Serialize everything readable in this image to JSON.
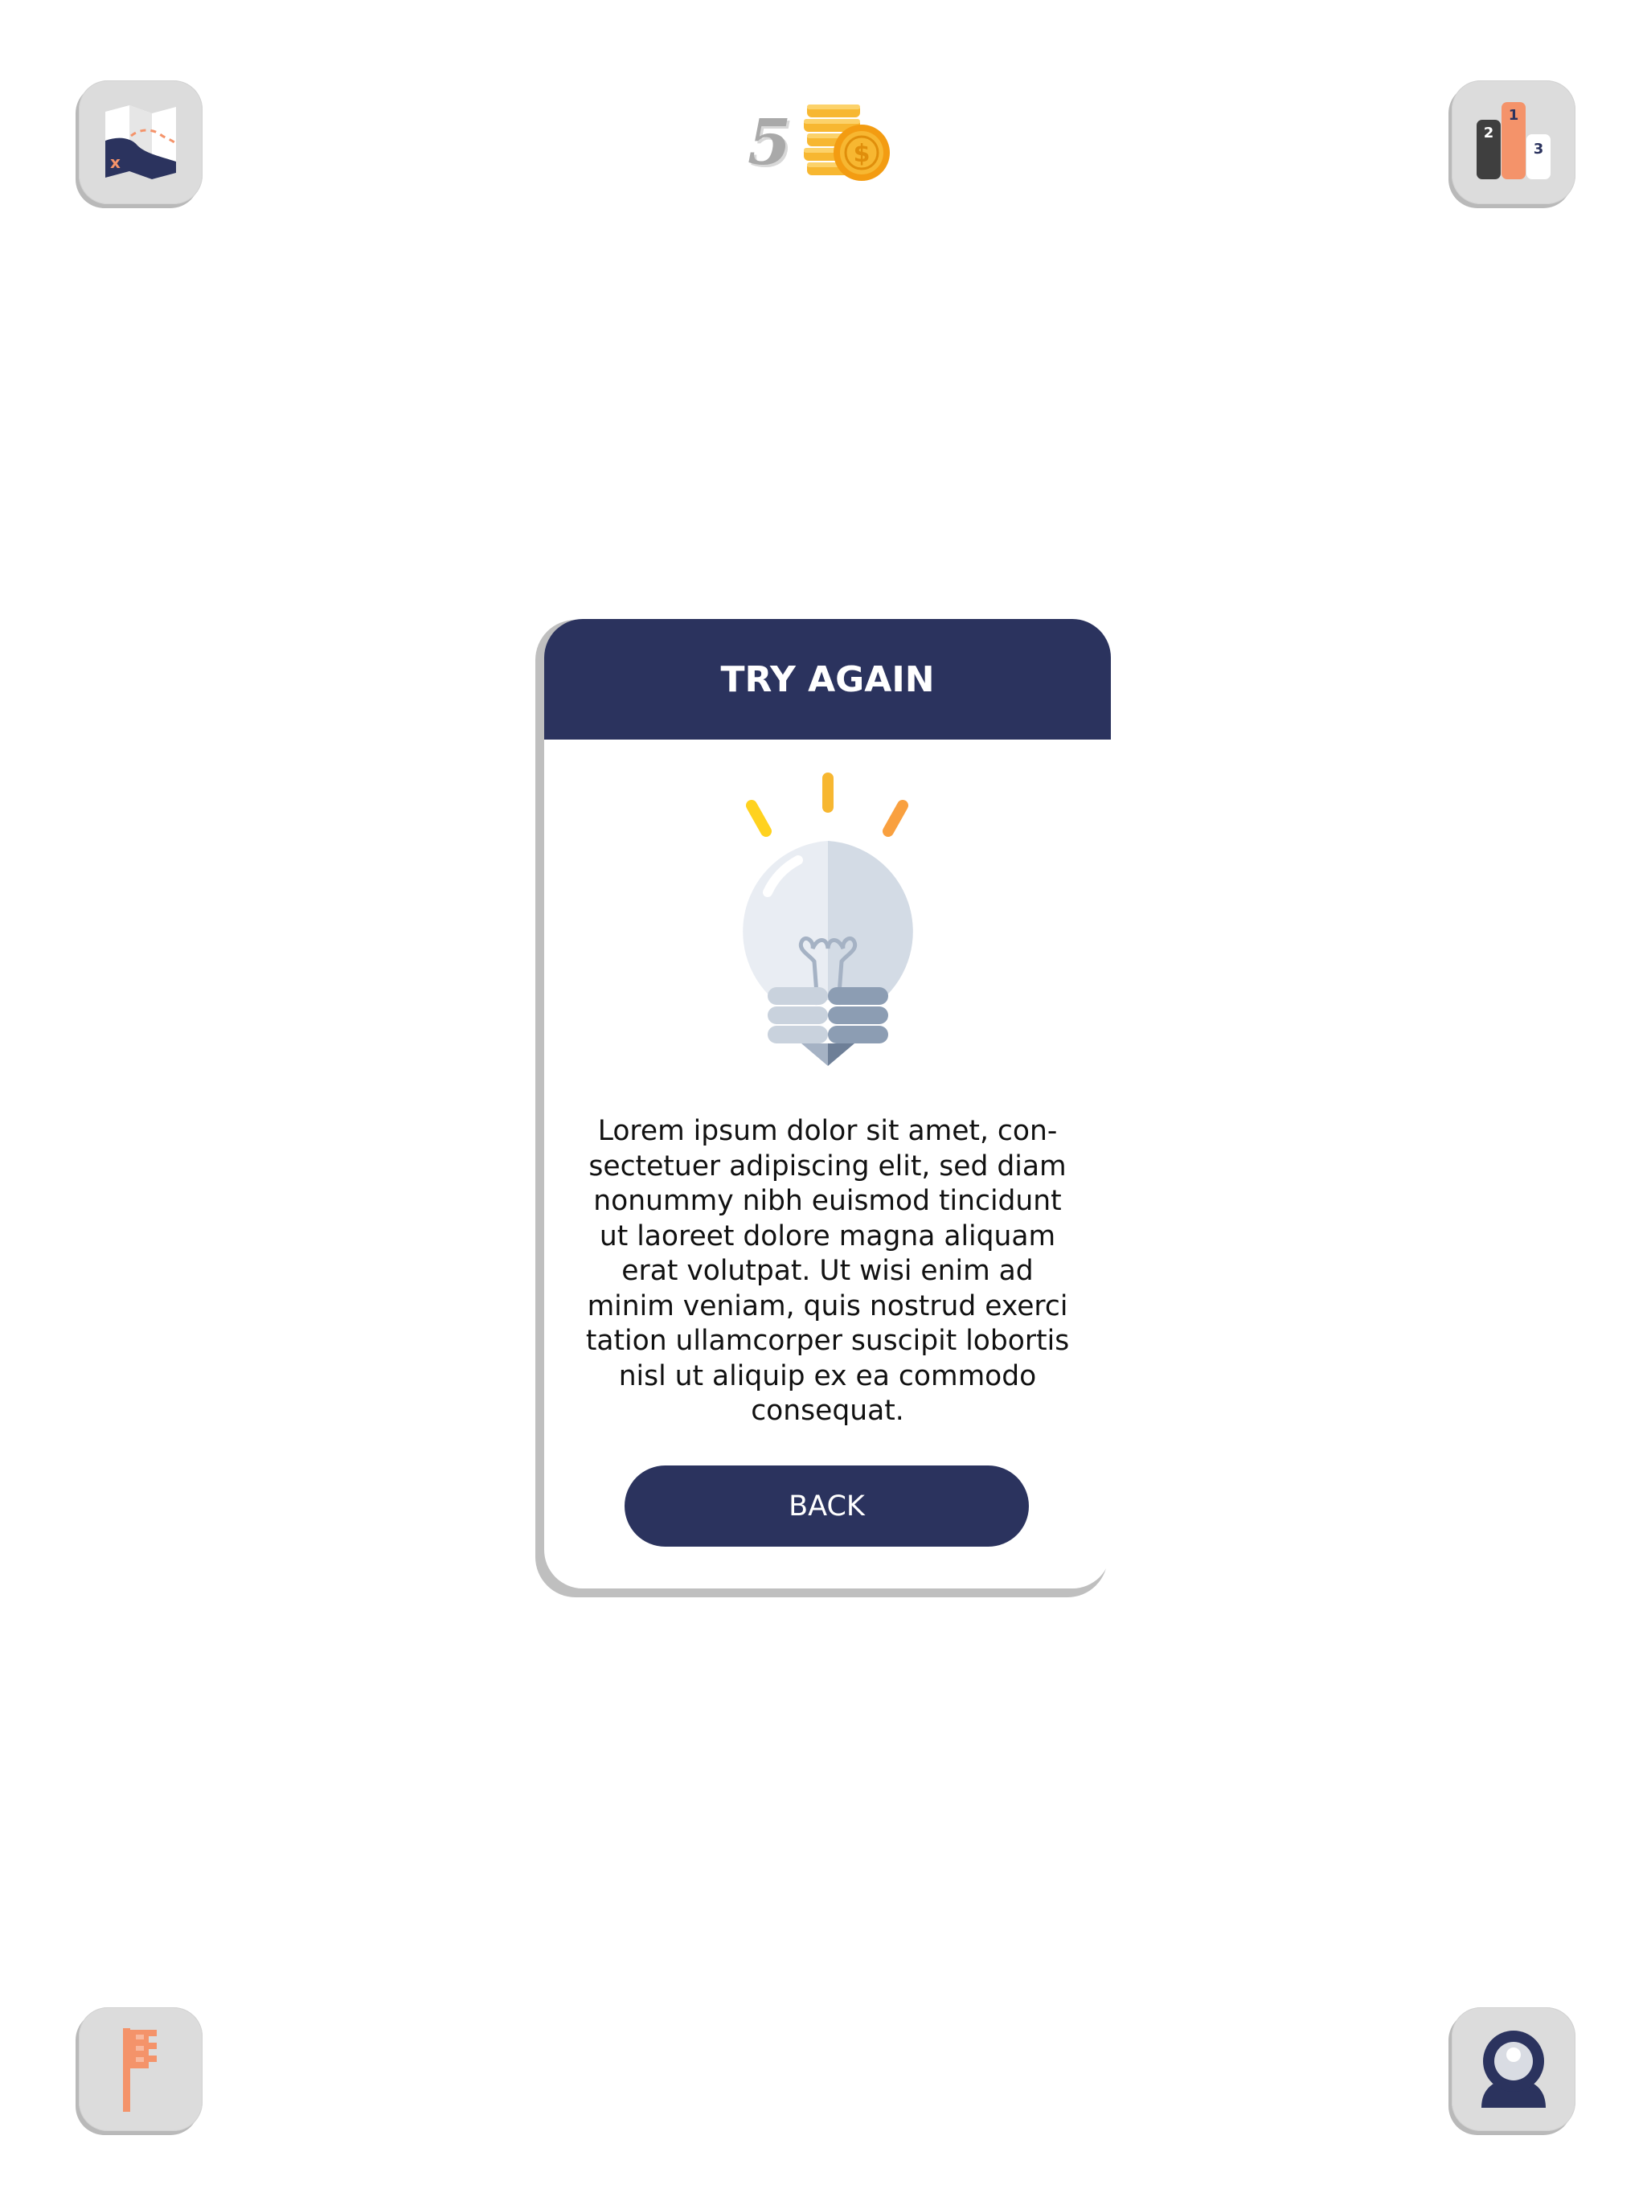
{
  "hud": {
    "coin_count": "5",
    "icons": {
      "top_left": "map-icon",
      "top_right": "leaderboard-podium-icon",
      "bottom_left": "flag-icon",
      "bottom_right": "user-profile-icon",
      "coins": "coin-stack-icon"
    },
    "podium_labels": [
      "2",
      "1",
      "3"
    ]
  },
  "dialog": {
    "title": "TRY AGAIN",
    "illustration": "lightbulb-icon",
    "body": "Lorem ipsum dolor sit amet, con-sectetuer adipiscing elit, sed diam nonummy nibh euismod tincidunt ut laoreet dolore magna aliquam erat volutpat. Ut wisi enim ad minim veniam, quis nostrud exerci tation ullamcorper suscipit lobortis nisl ut aliquip ex ea commodo consequat.",
    "button_label": "BACK"
  },
  "colors": {
    "navy": "#2b335e",
    "salmon": "#f4936a",
    "button_grey": "#dcdcdc",
    "coin_gold": "#f7b731"
  }
}
